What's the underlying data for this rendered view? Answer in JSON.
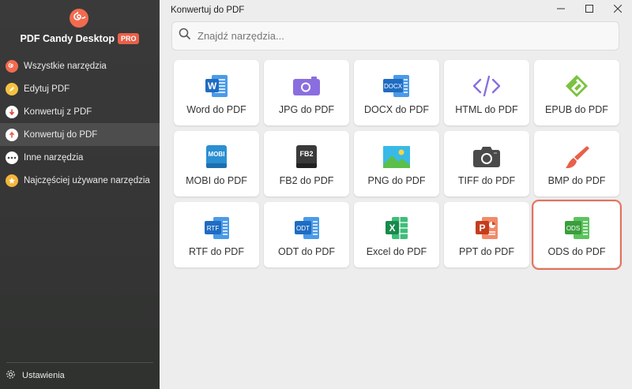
{
  "app": {
    "name": "PDF Candy Desktop",
    "badge": "PRO",
    "window_title": "Konwertuj do PDF"
  },
  "sidebar": {
    "items": [
      {
        "label": "Wszystkie narzędzia",
        "icon": "candy-logo-icon",
        "color": "#f26b4f"
      },
      {
        "label": "Edytuj PDF",
        "icon": "pen-icon",
        "color": "#f5c242"
      },
      {
        "label": "Konwertuj z PDF",
        "icon": "arrow-down-icon",
        "color": "#e24b3b"
      },
      {
        "label": "Konwertuj do PDF",
        "icon": "arrow-up-icon",
        "color": "#e8604a"
      },
      {
        "label": "Inne narzędzia",
        "icon": "more-dots-icon",
        "color": "#ffffff"
      },
      {
        "label": "Najczęściej używane narzędzia",
        "icon": "star-icon",
        "color": "#f5b53a"
      }
    ],
    "active": "Konwertuj do PDF",
    "settings_label": "Ustawienia"
  },
  "search": {
    "placeholder": "Znajdź narzędzia..."
  },
  "tools": [
    {
      "label": "Word do PDF",
      "icon": "word-icon",
      "tag": "W",
      "color": "#2b7cd3"
    },
    {
      "label": "JPG do PDF",
      "icon": "jpg-icon",
      "tag": "",
      "color": "#7d5bd6"
    },
    {
      "label": "DOCX do PDF",
      "icon": "docx-icon",
      "tag": "DOCX",
      "color": "#2b7cd3"
    },
    {
      "label": "HTML do PDF",
      "icon": "html-icon",
      "tag": "</>",
      "color": "#7d5bd6"
    },
    {
      "label": "EPUB do PDF",
      "icon": "epub-icon",
      "tag": "",
      "color": "#7cc242"
    },
    {
      "label": "MOBI do PDF",
      "icon": "mobi-icon",
      "tag": "MOBI",
      "color": "#2b8fd3"
    },
    {
      "label": "FB2 do PDF",
      "icon": "fb2-icon",
      "tag": "FB2",
      "color": "#3a3a3a"
    },
    {
      "label": "PNG do PDF",
      "icon": "png-icon",
      "tag": "",
      "color": "#39b9e8"
    },
    {
      "label": "TIFF do PDF",
      "icon": "tiff-icon",
      "tag": "",
      "color": "#4a4a4a"
    },
    {
      "label": "BMP do PDF",
      "icon": "bmp-icon",
      "tag": "",
      "color": "#e8604a"
    },
    {
      "label": "RTF do PDF",
      "icon": "rtf-icon",
      "tag": "RTF",
      "color": "#2b8fd3"
    },
    {
      "label": "ODT do PDF",
      "icon": "odt-icon",
      "tag": "ODT",
      "color": "#2b8fd3"
    },
    {
      "label": "Excel do PDF",
      "icon": "excel-icon",
      "tag": "X",
      "color": "#21a366"
    },
    {
      "label": "PPT do PDF",
      "icon": "ppt-icon",
      "tag": "P",
      "color": "#d24726"
    },
    {
      "label": "ODS do PDF",
      "icon": "ods-icon",
      "tag": "ODS",
      "color": "#46b548"
    }
  ],
  "selected_tool": "ODS do PDF"
}
